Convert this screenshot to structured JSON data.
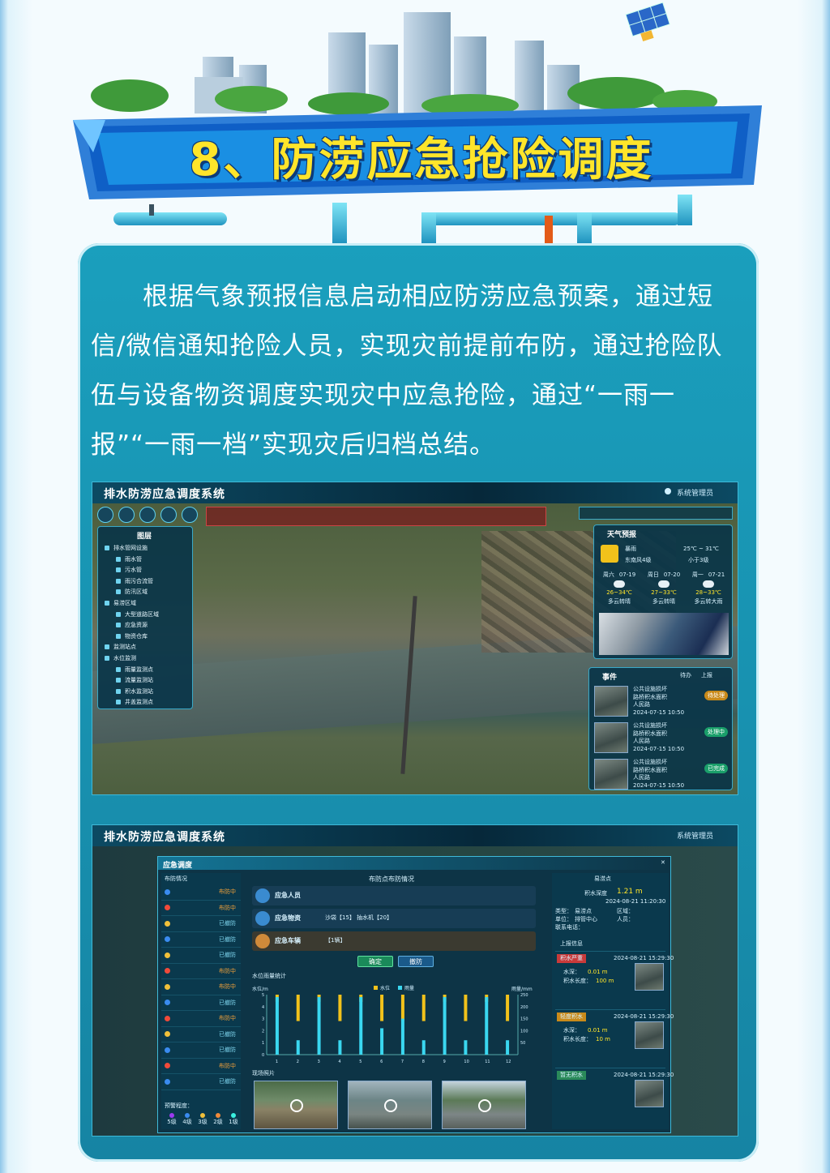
{
  "header": {
    "title": "8、防涝应急抢险调度"
  },
  "intro": {
    "text": "根据气象预报信息启动相应防涝应急预案，通过短信/微信通知抢险人员，实现灾前提前布防，通过抢险队伍与设备物资调度实现灾中应急抢险，通过“一雨一报”“一雨一档”实现灾后归档总结。"
  },
  "colors": {
    "accent": "#ffe52a",
    "card": "#1a9fbd",
    "screen_bg": "#0a2c3e",
    "border": "#3fb9d8"
  },
  "screen1": {
    "title": "排水防涝应急调度系统",
    "user": "系统管理员",
    "layers": {
      "title": "图层",
      "items": [
        "排水管网设施",
        "雨水管",
        "污水管",
        "雨污合流管",
        "防汛区域",
        "易涝区域",
        "大型道路区域",
        "应急资源",
        "物资仓库",
        "监测站点",
        "水位监测",
        "雨量监测点",
        "流量监测站",
        "积水监测站",
        "井盖监测点"
      ]
    },
    "weather": {
      "title": "天气预报",
      "now": "暴雨",
      "temp_range": "25℃ ~ 31℃",
      "wind": "东南风4级",
      "level": "小于3级",
      "days": [
        {
          "label": "周六",
          "date": "07-19",
          "range": "26~34℃",
          "desc": "多云转晴"
        },
        {
          "label": "周日",
          "date": "07-20",
          "range": "27~33℃",
          "desc": "多云转晴"
        },
        {
          "label": "周一",
          "date": "07-21",
          "range": "28~33℃",
          "desc": "多云转大雨"
        }
      ]
    },
    "events": {
      "title": "事件",
      "tabs": [
        "待办",
        "上报"
      ],
      "items": [
        {
          "type": "公共设施损坏",
          "unit": "路桥积水面积",
          "reporter": "人民路",
          "time": "2024-07-15 10:50",
          "status": "待处理"
        },
        {
          "type": "公共设施损坏",
          "unit": "路桥积水面积",
          "reporter": "人民路",
          "time": "2024-07-15 10:50",
          "status": "处理中"
        },
        {
          "type": "公共设施损坏",
          "unit": "路桥积水面积",
          "reporter": "人民路",
          "time": "2024-07-15 10:50",
          "status": "已完成"
        }
      ]
    }
  },
  "screen2": {
    "title": "排水防涝应急调度系统",
    "user": "系统管理员",
    "dialog_title": "应急调度",
    "list_title": "布防情况",
    "list": [
      {
        "status": "布防中",
        "color": "#3a8bf0"
      },
      {
        "status": "布防中",
        "color": "#f04a3a"
      },
      {
        "status": "已撤防",
        "color": "#f0c03a"
      },
      {
        "status": "已撤防",
        "color": "#3a8bf0"
      },
      {
        "status": "已撤防",
        "color": "#f0c03a"
      },
      {
        "status": "布防中",
        "color": "#f04a3a"
      },
      {
        "status": "布防中",
        "color": "#f0c03a"
      },
      {
        "status": "已撤防",
        "color": "#3a8bf0"
      },
      {
        "status": "布防中",
        "color": "#f04a3a"
      },
      {
        "status": "已撤防",
        "color": "#f0c03a"
      },
      {
        "status": "已撤防",
        "color": "#3a8bf0"
      },
      {
        "status": "布防中",
        "color": "#f04a3a"
      },
      {
        "status": "已撤防",
        "color": "#3a8bf0"
      }
    ],
    "legend_title": "预警程度：",
    "levels": [
      "5级",
      "4级",
      "3级",
      "2级",
      "1级"
    ],
    "level_colors": [
      "#9b3af0",
      "#3a8bf0",
      "#f0c03a",
      "#f08a3a",
      "#3af0e0"
    ],
    "center_title": "布防点布防情况",
    "resources": [
      {
        "label": "应急人员"
      },
      {
        "label": "应急物资",
        "content": "沙袋【15】  抽水机【20】"
      },
      {
        "label": "应急车辆",
        "content": "【1辆】"
      }
    ],
    "buttons": [
      "确定",
      "撤防"
    ],
    "chart_title": "水位雨量统计",
    "chart_legend": [
      "水位",
      "雨量"
    ],
    "photos_title": "现场照片",
    "right_title": "易涝点",
    "right_info": {
      "depth_label": "积水深度",
      "depth": "1.21 m",
      "time": "2024-08-21 11:20:30",
      "type_label": "类型：",
      "type": "易涝点",
      "area_label": "区域：",
      "unit_label": "单位：",
      "unit": "排管中心",
      "person_label": "人员：",
      "phone_label": "联系电话："
    },
    "reports_title": "上报信息",
    "reports": [
      {
        "title": "积水严重",
        "time": "2024-08-21 15:29:30",
        "depth": "0.01 m",
        "len": "100 m"
      },
      {
        "title": "轻度积水",
        "time": "2024-08-21 15:29:30",
        "depth": "0.01 m",
        "len": "10 m"
      },
      {
        "title": "暂无积水",
        "time": "2024-08-21 15:29:30"
      }
    ],
    "report_labels": {
      "depth": "水深：",
      "len": "积水长度："
    },
    "chart_data": {
      "type": "bar",
      "categories": [
        "1",
        "2",
        "3",
        "4",
        "5",
        "6",
        "7",
        "8",
        "9",
        "10",
        "11",
        "12"
      ],
      "series": [
        {
          "name": "水位",
          "values": [
            0.6,
            2.2,
            0.6,
            2.2,
            0.6,
            2.2,
            2.2,
            2.2,
            0.6,
            2.2,
            0.6,
            2.2
          ]
        },
        {
          "name": "雨量",
          "values": [
            240,
            60,
            240,
            60,
            240,
            110,
            150,
            60,
            240,
            60,
            240,
            60
          ]
        }
      ],
      "ylabel": "水位/m",
      "ylabel2": "雨量/mm",
      "ylim": [
        0,
        5
      ],
      "y2lim": [
        0,
        250
      ],
      "yticks": [
        "0",
        "1",
        "2",
        "3",
        "4",
        "5"
      ],
      "y2ticks": [
        "50",
        "100",
        "150",
        "200",
        "250"
      ]
    }
  }
}
